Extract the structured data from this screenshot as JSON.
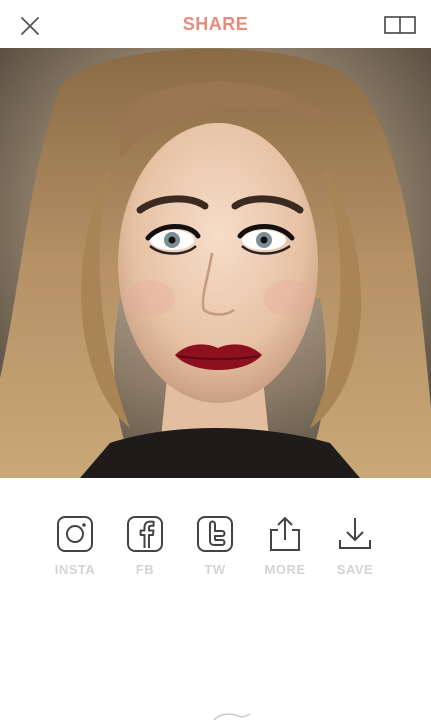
{
  "header": {
    "title": "SHARE",
    "title_color": "#ea8a7b",
    "close_icon": "close-icon",
    "compare_icon": "split-view-icon"
  },
  "photo": {
    "description_icon": "portrait-photo"
  },
  "share": {
    "items": [
      {
        "label": "INSTA",
        "icon": "instagram-icon"
      },
      {
        "label": "FB",
        "icon": "facebook-icon"
      },
      {
        "label": "TW",
        "icon": "twitter-icon"
      },
      {
        "label": "MORE",
        "icon": "share-up-icon"
      },
      {
        "label": "SAVE",
        "icon": "download-icon"
      }
    ],
    "label_color": "#d4d4d4"
  }
}
